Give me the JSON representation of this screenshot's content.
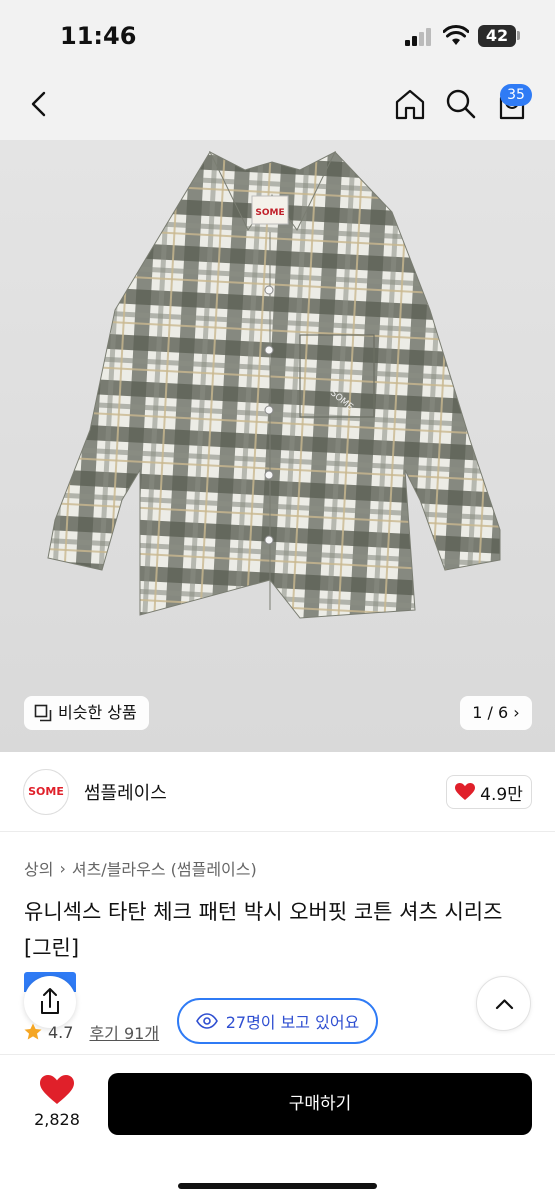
{
  "status_bar": {
    "time": "11:46",
    "battery": "42"
  },
  "nav": {
    "cart_count": "35"
  },
  "gallery": {
    "similar_label": "비슷한 상품",
    "counter": "1 / 6"
  },
  "seller": {
    "logo_text": "SOME",
    "name": "썸플레이스",
    "likes": "4.9만"
  },
  "breadcrumb": {
    "level1": "상의",
    "level2": "셔츠/블라우스 (썸플레이스)"
  },
  "product": {
    "title": "유니섹스 타탄 체크 패턴 박시 오버핏 코튼 셔츠 시리즈 [그린]",
    "rating": "4.7",
    "reviews": "후기 91개",
    "viewers": "27명이 보고 있어요"
  },
  "bottom_bar": {
    "like_count": "2,828",
    "buy_label": "구매하기"
  },
  "colors": {
    "accent": "#2f7bf5",
    "heart": "#e0202a",
    "buy_button": "#000000"
  }
}
